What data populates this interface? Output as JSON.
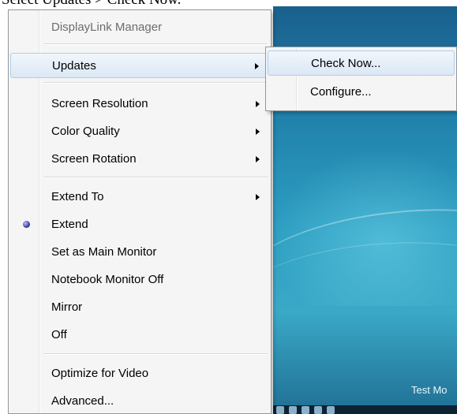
{
  "caption": "Select Updates > Check Now.",
  "desktop": {
    "label": "Test Mo"
  },
  "menu": {
    "title": "DisplayLink Manager",
    "updates": "Updates",
    "screen_resolution": "Screen Resolution",
    "color_quality": "Color Quality",
    "screen_rotation": "Screen Rotation",
    "extend_to": "Extend To",
    "extend": "Extend",
    "set_main": "Set as Main Monitor",
    "notebook_off": "Notebook Monitor Off",
    "mirror": "Mirror",
    "off": "Off",
    "optimize_video": "Optimize for Video",
    "advanced": "Advanced..."
  },
  "submenu": {
    "check_now": "Check Now...",
    "configure": "Configure..."
  },
  "colors": {
    "highlight_border": "#aecdef",
    "menu_bg": "#f5f5f5"
  }
}
